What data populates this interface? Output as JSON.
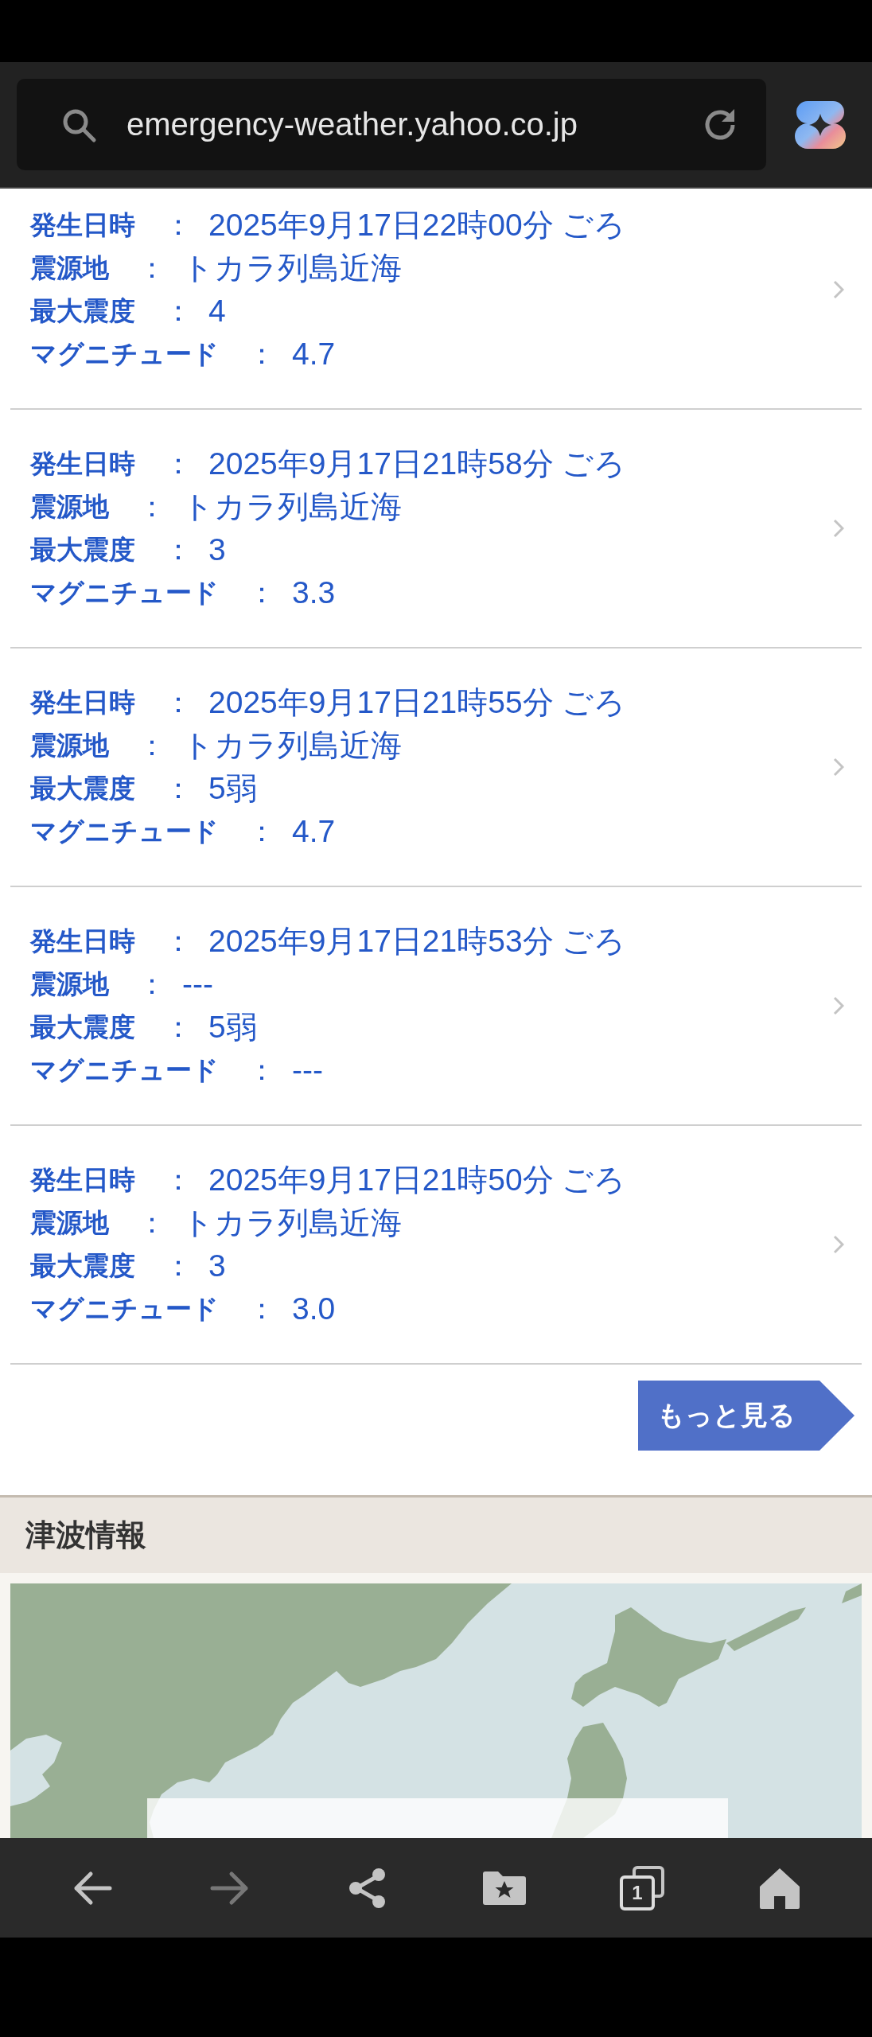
{
  "browser": {
    "url": "emergency-weather.yahoo.co.jp"
  },
  "earthquakes": [
    {
      "fields": [
        {
          "label": "発生日時",
          "sep": "：",
          "value": "2025年9月17日22時00分 ごろ"
        },
        {
          "label": "震源地",
          "sep": "：",
          "value": "トカラ列島近海"
        },
        {
          "label": "最大震度",
          "sep": "：",
          "value": "4"
        },
        {
          "label": "マグニチュード",
          "sep": "：",
          "value": "4.7"
        }
      ]
    },
    {
      "fields": [
        {
          "label": "発生日時",
          "sep": "：",
          "value": "2025年9月17日21時58分 ごろ"
        },
        {
          "label": "震源地",
          "sep": "：",
          "value": "トカラ列島近海"
        },
        {
          "label": "最大震度",
          "sep": "：",
          "value": "3"
        },
        {
          "label": "マグニチュード",
          "sep": "：",
          "value": "3.3"
        }
      ]
    },
    {
      "fields": [
        {
          "label": "発生日時",
          "sep": "：",
          "value": "2025年9月17日21時55分 ごろ"
        },
        {
          "label": "震源地",
          "sep": "：",
          "value": "トカラ列島近海"
        },
        {
          "label": "最大震度",
          "sep": "：",
          "value": "5弱"
        },
        {
          "label": "マグニチュード",
          "sep": "：",
          "value": "4.7"
        }
      ]
    },
    {
      "fields": [
        {
          "label": "発生日時",
          "sep": "：",
          "value": "2025年9月17日21時53分 ごろ"
        },
        {
          "label": "震源地",
          "sep": "：",
          "value": "---"
        },
        {
          "label": "最大震度",
          "sep": "：",
          "value": "5弱"
        },
        {
          "label": "マグニチュード",
          "sep": "：",
          "value": "---"
        }
      ]
    },
    {
      "fields": [
        {
          "label": "発生日時",
          "sep": "：",
          "value": "2025年9月17日21時50分 ごろ"
        },
        {
          "label": "震源地",
          "sep": "：",
          "value": "トカラ列島近海"
        },
        {
          "label": "最大震度",
          "sep": "：",
          "value": "3"
        },
        {
          "label": "マグニチュード",
          "sep": "：",
          "value": "3.0"
        }
      ]
    }
  ],
  "more_button": "もっと見る",
  "tsunami": {
    "title": "津波情報"
  },
  "nav_bar": [
    {
      "kind": "back",
      "disabled": false
    },
    {
      "kind": "forward",
      "disabled": true
    },
    {
      "kind": "share",
      "disabled": false
    },
    {
      "kind": "bookmarks",
      "disabled": false
    },
    {
      "kind": "tabs",
      "disabled": false,
      "count": "1"
    },
    {
      "kind": "home",
      "disabled": false
    }
  ]
}
